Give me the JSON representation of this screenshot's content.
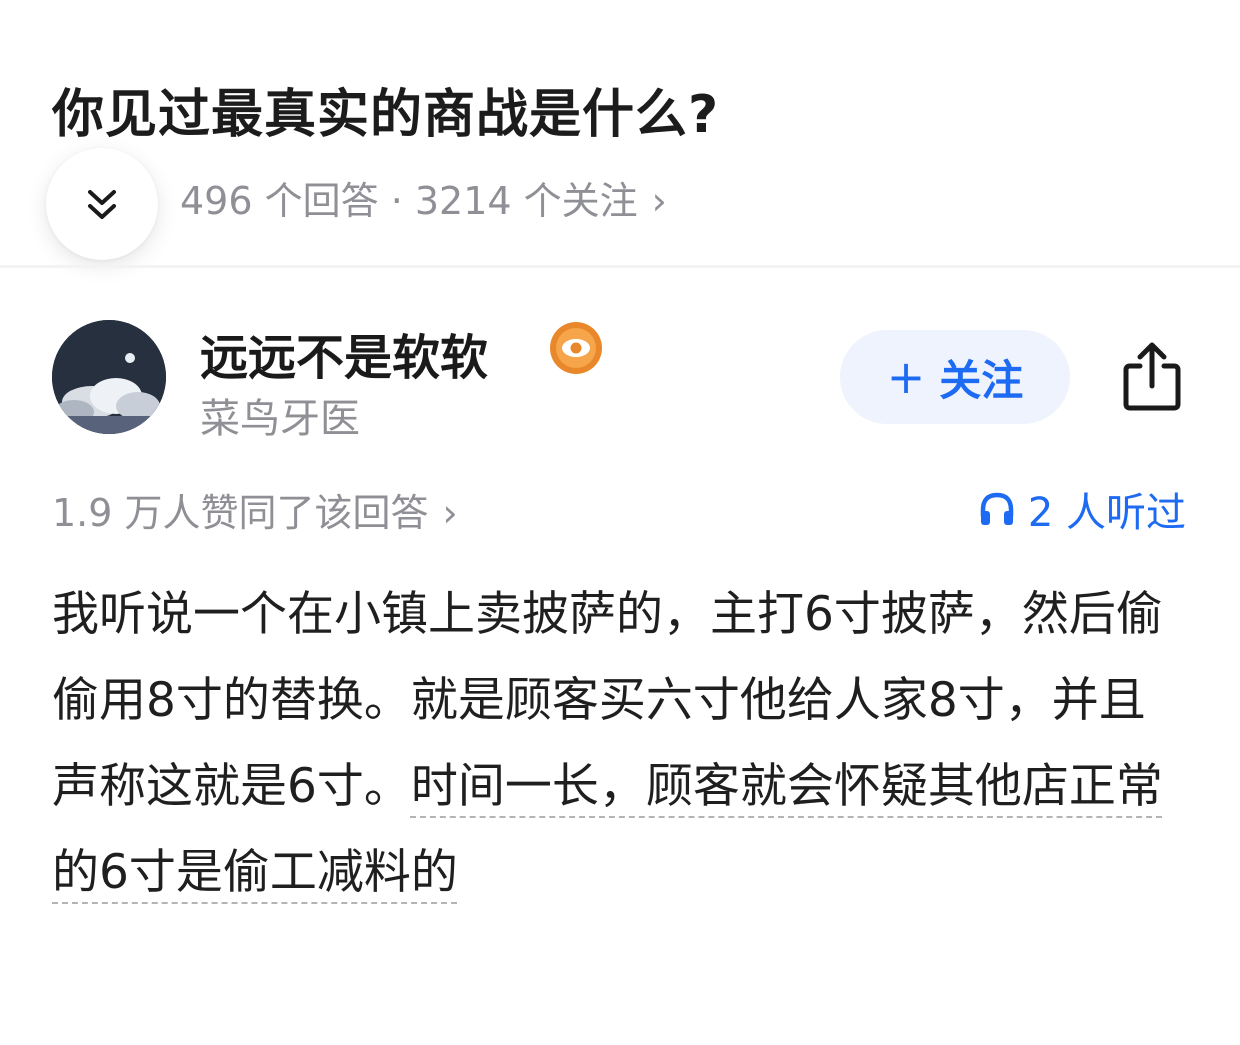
{
  "question": {
    "title": "你见过最真实的商战是什么?",
    "stats": "496 个回答 · 3214 个关注",
    "stats_chevron": "›"
  },
  "author": {
    "name": "远远不是软软",
    "description": "菜鸟牙医",
    "badge_icon": "eye-badge-icon",
    "follow_plus": "+",
    "follow_label": "关注"
  },
  "answer": {
    "likes": "1.9 万人赞同了该回答",
    "likes_chevron": "›",
    "listen": "2 人听过",
    "content_part1": "我听说一个在小镇上卖披萨的，主打6寸披萨，然后偷偷用8寸的替换。就是顾客买六寸他给人家8寸，并且声称这就是6寸。",
    "content_part2": "时间一长，顾客就会怀疑其他店正常的6寸是偷工减料的"
  },
  "colors": {
    "accent": "#1d6bf2",
    "muted_text": "#8f8f96",
    "follow_bg": "#eef3fd",
    "badge_orange": "#e8882a"
  }
}
